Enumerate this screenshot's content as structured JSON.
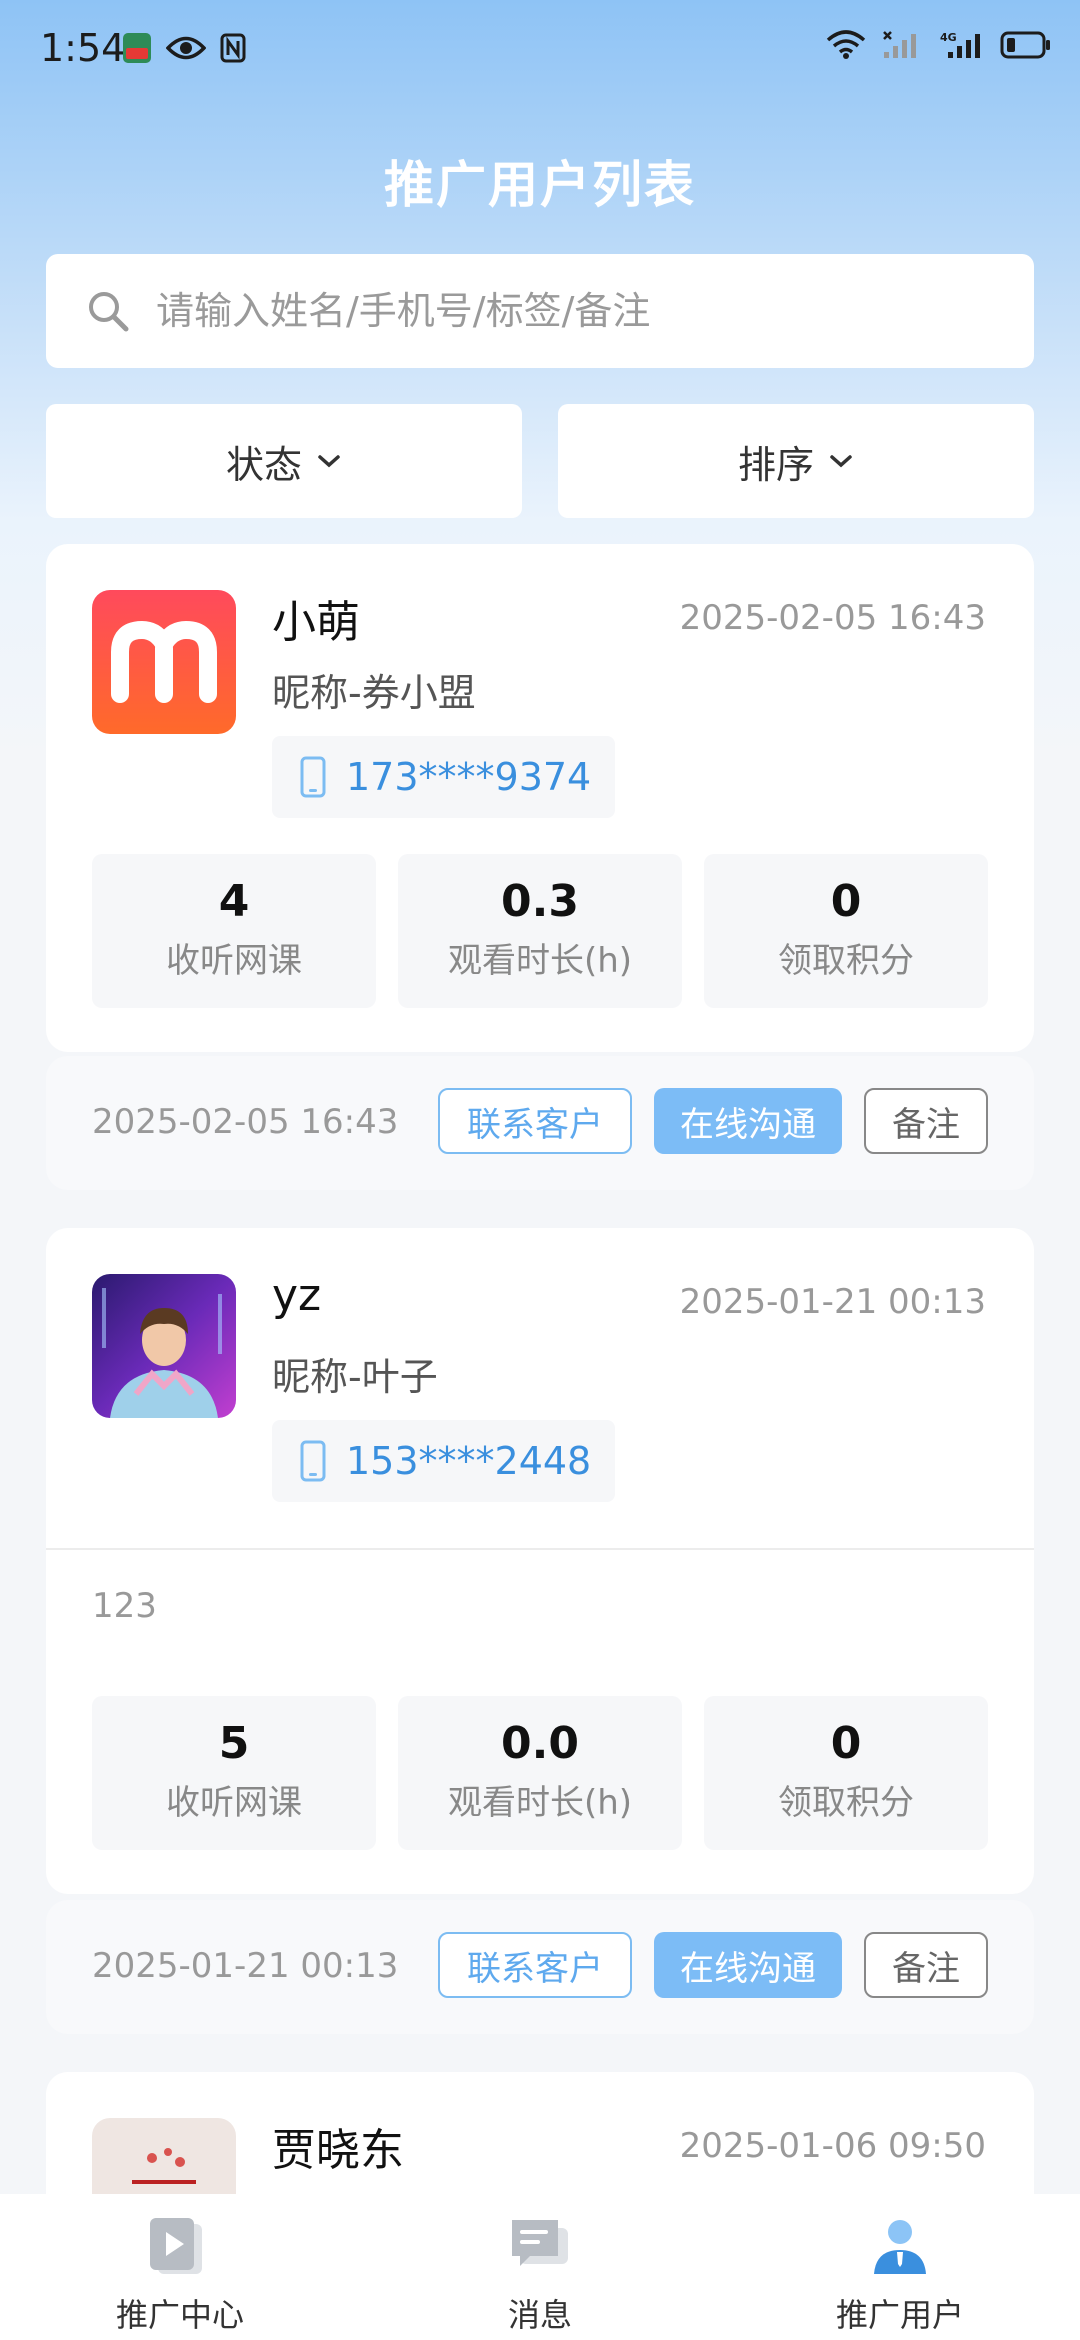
{
  "status_bar": {
    "time": "1:54"
  },
  "page": {
    "title": "推广用户列表"
  },
  "search": {
    "placeholder": "请输入姓名/手机号/标签/备注"
  },
  "filters": {
    "status": "状态",
    "sort": "排序"
  },
  "users": [
    {
      "name": "小萌",
      "date": "2025-02-05 16:43",
      "nickname": "昵称-券小盟",
      "phone": "173****9374",
      "remark": "",
      "stats": [
        {
          "value": "4",
          "label": "收听网课"
        },
        {
          "value": "0.3",
          "label": "观看时长(h)"
        },
        {
          "value": "0",
          "label": "领取积分"
        }
      ],
      "footer_date": "2025-02-05 16:43",
      "buttons": {
        "contact": "联系客户",
        "chat": "在线沟通",
        "note": "备注"
      }
    },
    {
      "name": "yz",
      "date": "2025-01-21 00:13",
      "nickname": "昵称-叶子",
      "phone": "153****2448",
      "remark": "123",
      "stats": [
        {
          "value": "5",
          "label": "收听网课"
        },
        {
          "value": "0.0",
          "label": "观看时长(h)"
        },
        {
          "value": "0",
          "label": "领取积分"
        }
      ],
      "footer_date": "2025-01-21 00:13",
      "buttons": {
        "contact": "联系客户",
        "chat": "在线沟通",
        "note": "备注"
      }
    },
    {
      "name": "贾晓东",
      "date": "2025-01-06 09:50"
    }
  ],
  "tabbar": {
    "items": [
      {
        "label": "推广中心",
        "icon": "play-icon"
      },
      {
        "label": "消息",
        "icon": "chat-icon"
      },
      {
        "label": "推广用户",
        "icon": "user-icon",
        "active": true
      }
    ]
  },
  "colors": {
    "accent": "#3a8fde",
    "button_fill": "#7cbcf6",
    "header_gradient_top": "#8ec3f5"
  }
}
